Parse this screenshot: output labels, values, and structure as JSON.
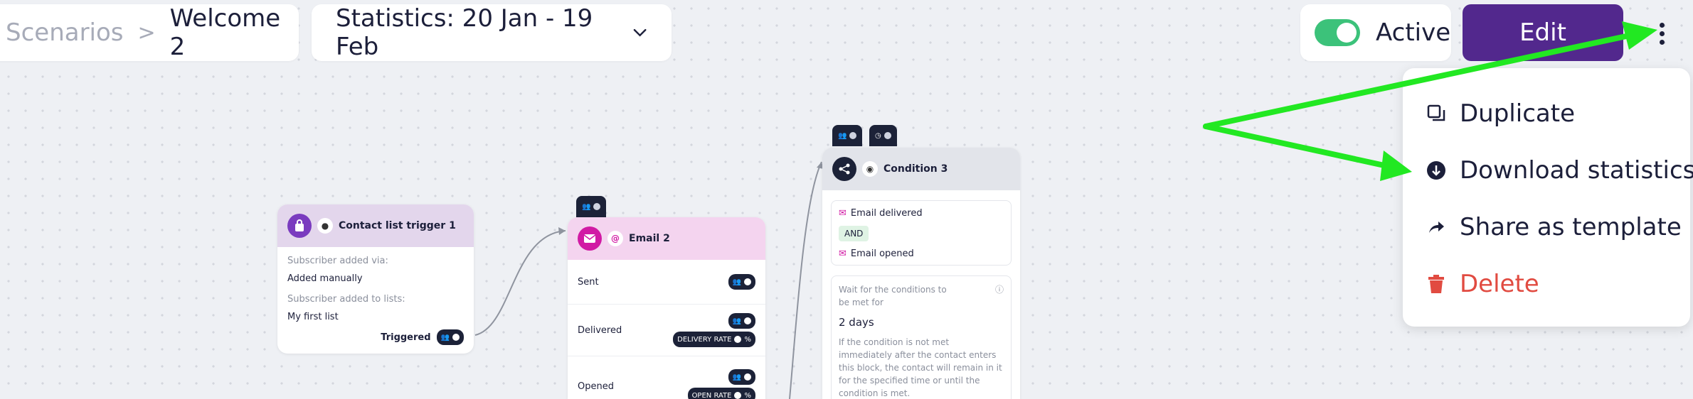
{
  "breadcrumb": {
    "parent": "Scenarios",
    "separator": ">",
    "current": "Welcome 2"
  },
  "stats_select": {
    "label": "Statistics: 20 Jan - 19 Feb",
    "icon": "chevron-down-icon"
  },
  "active": {
    "label": "Active",
    "state": "on",
    "color": "#3cc27a"
  },
  "edit_button": {
    "label": "Edit",
    "color": "#52288d"
  },
  "menu": {
    "items": [
      {
        "label": "Duplicate",
        "icon": "duplicate-icon"
      },
      {
        "label": "Download statistics",
        "icon": "download-icon"
      },
      {
        "label": "Share as template",
        "icon": "share-icon"
      },
      {
        "label": "Delete",
        "icon": "trash-icon",
        "color": "#e14b41"
      }
    ]
  },
  "annotation": {
    "arrow_color": "#22e822"
  },
  "nodes": {
    "trigger": {
      "title": "Contact list trigger 1",
      "added_via_label": "Subscriber added via:",
      "added_via_value": "Added manually",
      "lists_label": "Subscriber added to lists:",
      "lists_value": "My first list",
      "footer_label": "Triggered"
    },
    "email": {
      "title": "Email 2",
      "rows": [
        {
          "label": "Sent"
        },
        {
          "label": "Delivered",
          "rate_label": "DELIVERY RATE",
          "suffix": "%"
        },
        {
          "label": "Opened",
          "rate_label": "OPEN RATE",
          "suffix": "%"
        }
      ]
    },
    "condition": {
      "title": "Condition 3",
      "cond1": "Email delivered",
      "operator": "AND",
      "cond2": "Email opened",
      "wait_label": "Wait for the conditions to be met for",
      "wait_value": "2 days",
      "wait_note": "If the condition is not met immediately after the contact enters this block, the contact will remain in it for the specified time or until the condition is met."
    }
  }
}
